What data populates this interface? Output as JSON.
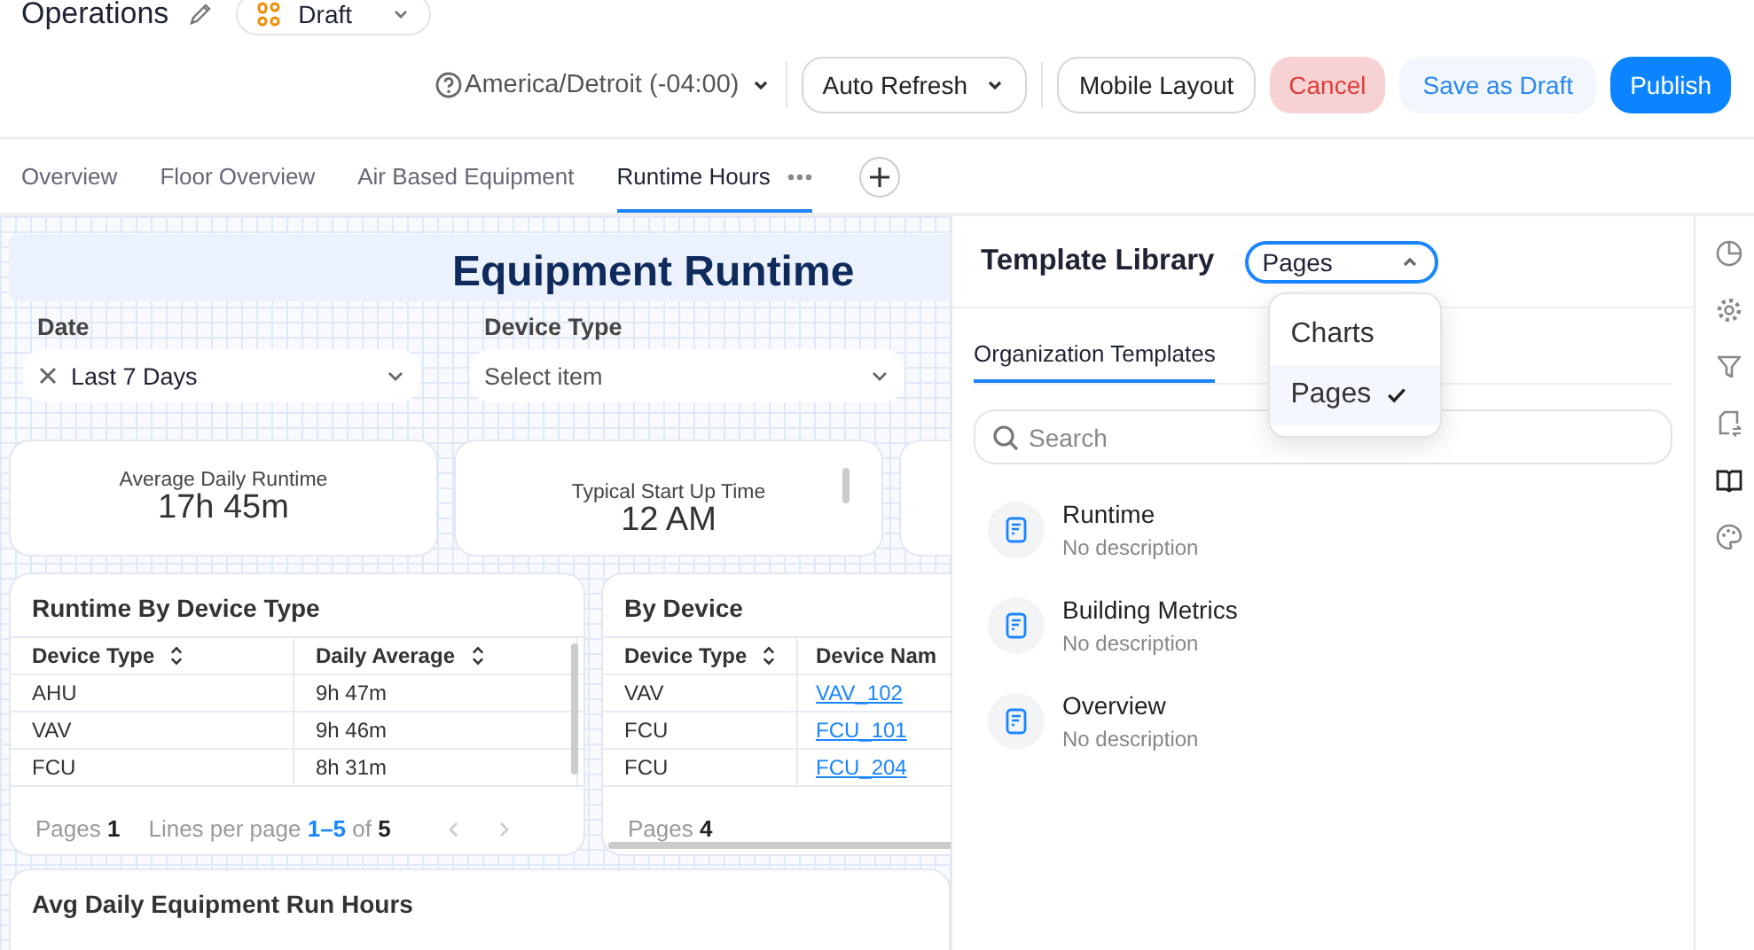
{
  "header": {
    "title": "Operations",
    "status": "Draft",
    "timezone": "America/Detroit (-04:00)",
    "auto_refresh": "Auto Refresh",
    "buttons": [
      {
        "label": "Mobile Layout",
        "kind": "outline"
      },
      {
        "label": "Cancel",
        "kind": "danger"
      },
      {
        "label": "Save as Draft",
        "kind": "soft"
      },
      {
        "label": "Publish",
        "kind": "primary"
      }
    ]
  },
  "tabs": [
    {
      "label": "Overview",
      "selected": false
    },
    {
      "label": "Floor Overview",
      "selected": false
    },
    {
      "label": "Air Based Equipment",
      "selected": false
    },
    {
      "label": "Runtime Hours",
      "selected": true
    }
  ],
  "dashboard": {
    "title": "Equipment Runtime",
    "filters": [
      {
        "label": "Date",
        "value": "Last 7 Days"
      },
      {
        "label": "Device Type",
        "placeholder": "Select item"
      }
    ],
    "kpis": [
      {
        "label": "Average Daily Runtime",
        "value": "17h 45m"
      },
      {
        "label": "Typical Start Up Time",
        "value": "12 AM"
      }
    ],
    "tables": [
      {
        "title": "Runtime By Device Type",
        "columns": [
          {
            "label": "Device Type",
            "sortable": true,
            "kind": "text"
          },
          {
            "label": "Daily Average",
            "sortable": true,
            "kind": "text"
          }
        ],
        "rows": [
          [
            "AHU",
            "9h 47m"
          ],
          [
            "VAV",
            "9h 46m"
          ],
          [
            "FCU",
            "8h 31m"
          ]
        ],
        "pager": {
          "pages": "Pages",
          "page_count": "1",
          "lines": "Lines per page",
          "range": "1–5",
          "of": "of",
          "total": "5"
        }
      },
      {
        "title": "By Device",
        "columns": [
          {
            "label": "Device Type",
            "sortable": true,
            "kind": "text"
          },
          {
            "label": "Device Nam",
            "kind": "link"
          }
        ],
        "rows": [
          [
            "VAV",
            "VAV_102"
          ],
          [
            "FCU",
            "FCU_101"
          ],
          [
            "FCU",
            "FCU_204"
          ]
        ],
        "pager": {
          "pages": "Pages",
          "page_count": "4"
        }
      }
    ],
    "chart_card": {
      "title": "Avg Daily Equipment Run Hours"
    }
  },
  "library": {
    "title": "Template Library",
    "type_select": {
      "value": "Pages",
      "open": true,
      "options": [
        {
          "label": "Charts",
          "selected": false
        },
        {
          "label": "Pages",
          "selected": true
        }
      ]
    },
    "tabs": [
      {
        "label": "Organization Templates",
        "selected": true
      }
    ],
    "search": {
      "placeholder": "Search"
    },
    "templates": [
      {
        "name": "Runtime",
        "description": "No description"
      },
      {
        "name": "Building Metrics",
        "description": "No description"
      },
      {
        "name": "Overview",
        "description": "No description"
      }
    ]
  },
  "rail": [
    {
      "kind": "pie",
      "selected": false
    },
    {
      "kind": "gear",
      "selected": false
    },
    {
      "kind": "filter",
      "selected": false
    },
    {
      "kind": "swap",
      "selected": false
    },
    {
      "kind": "book",
      "selected": true
    },
    {
      "kind": "palette",
      "selected": false
    }
  ]
}
